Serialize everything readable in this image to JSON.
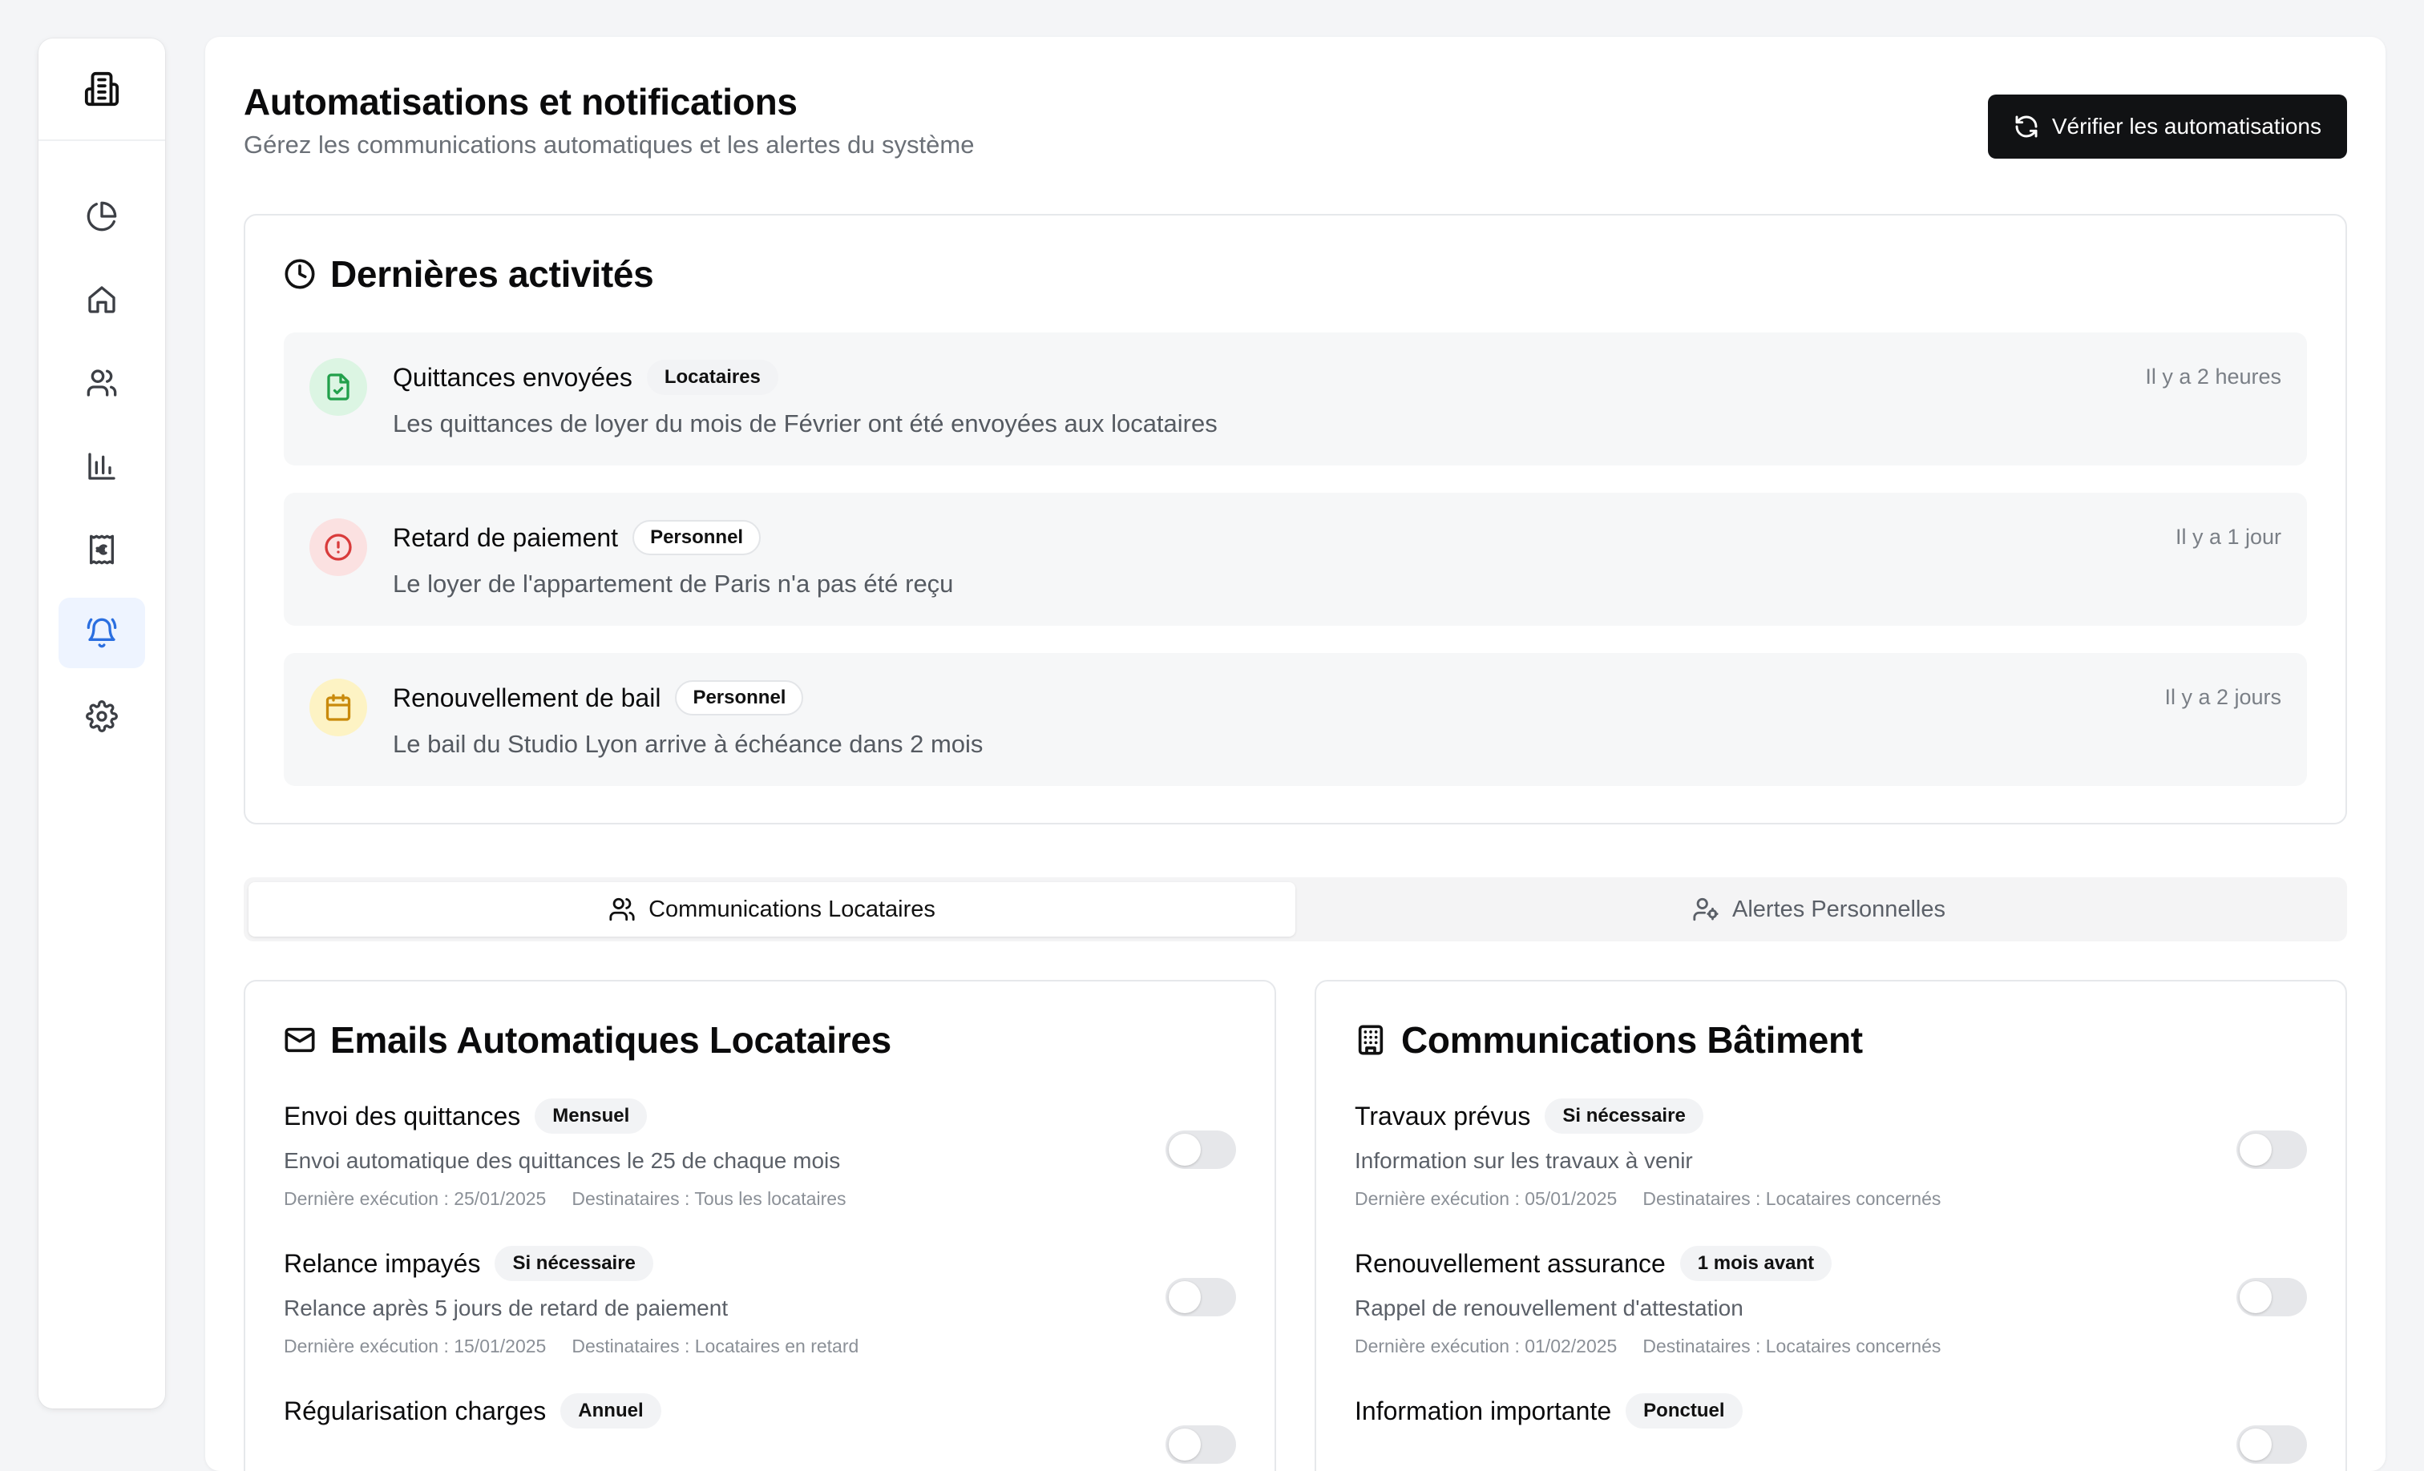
{
  "sidebar": {
    "logo_icon": "building-icon",
    "items": [
      {
        "id": "dashboard",
        "icon": "pie-chart-icon"
      },
      {
        "id": "properties",
        "icon": "home-icon"
      },
      {
        "id": "tenants",
        "icon": "users-icon"
      },
      {
        "id": "reports",
        "icon": "bar-chart-icon"
      },
      {
        "id": "finance",
        "icon": "euro-receipt-icon"
      },
      {
        "id": "notifications",
        "icon": "bell-ring-icon",
        "active": true
      },
      {
        "id": "settings",
        "icon": "gear-icon"
      }
    ]
  },
  "header": {
    "title": "Automatisations et notifications",
    "subtitle": "Gérez les communications automatiques et les alertes du système",
    "check_button": "Vérifier les automatisations"
  },
  "activities": {
    "title": "Dernières activités",
    "items": [
      {
        "title": "Quittances envoyées",
        "badge": "Locataires",
        "desc": "Les quittances de loyer du mois de Février ont été envoyées aux locataires",
        "time": "Il y a 2 heures",
        "icon": "file-check-icon",
        "color": "#22a04b"
      },
      {
        "title": "Retard de paiement",
        "badge": "Personnel",
        "desc": "Le loyer de l'appartement de Paris n'a pas été reçu",
        "time": "Il y a 1 jour",
        "icon": "alert-circle-icon",
        "color": "#d93b3b"
      },
      {
        "title": "Renouvellement de bail",
        "badge": "Personnel",
        "desc": "Le bail du Studio Lyon arrive à échéance dans 2 mois",
        "time": "Il y a 2 jours",
        "icon": "calendar-icon",
        "color": "#c98a0b"
      }
    ]
  },
  "tabs": [
    {
      "label": "Communications Locataires",
      "active": true
    },
    {
      "label": "Alertes Personnelles",
      "active": false
    }
  ],
  "panels": {
    "tenant_emails": {
      "title": "Emails Automatiques Locataires",
      "rules": [
        {
          "title": "Envoi des quittances",
          "badge": "Mensuel",
          "desc": "Envoi automatique des quittances le 25 de chaque mois",
          "last_run": "Dernière exécution : 25/01/2025",
          "recipients": "Destinataires : Tous les locataires",
          "enabled": false
        },
        {
          "title": "Relance impayés",
          "badge": "Si nécessaire",
          "desc": "Relance après 5 jours de retard de paiement",
          "last_run": "Dernière exécution : 15/01/2025",
          "recipients": "Destinataires : Locataires en retard",
          "enabled": false
        },
        {
          "title": "Régularisation charges",
          "badge": "Annuel",
          "desc": "",
          "last_run": "",
          "recipients": "",
          "enabled": false
        }
      ]
    },
    "building": {
      "title": "Communications Bâtiment",
      "rules": [
        {
          "title": "Travaux prévus",
          "badge": "Si nécessaire",
          "desc": "Information sur les travaux à venir",
          "last_run": "Dernière exécution : 05/01/2025",
          "recipients": "Destinataires : Locataires concernés",
          "enabled": false
        },
        {
          "title": "Renouvellement assurance",
          "badge": "1 mois avant",
          "desc": "Rappel de renouvellement d'attestation",
          "last_run": "Dernière exécution : 01/02/2025",
          "recipients": "Destinataires : Locataires concernés",
          "enabled": false
        },
        {
          "title": "Information importante",
          "badge": "Ponctuel",
          "desc": "",
          "last_run": "",
          "recipients": "",
          "enabled": false
        }
      ]
    }
  }
}
